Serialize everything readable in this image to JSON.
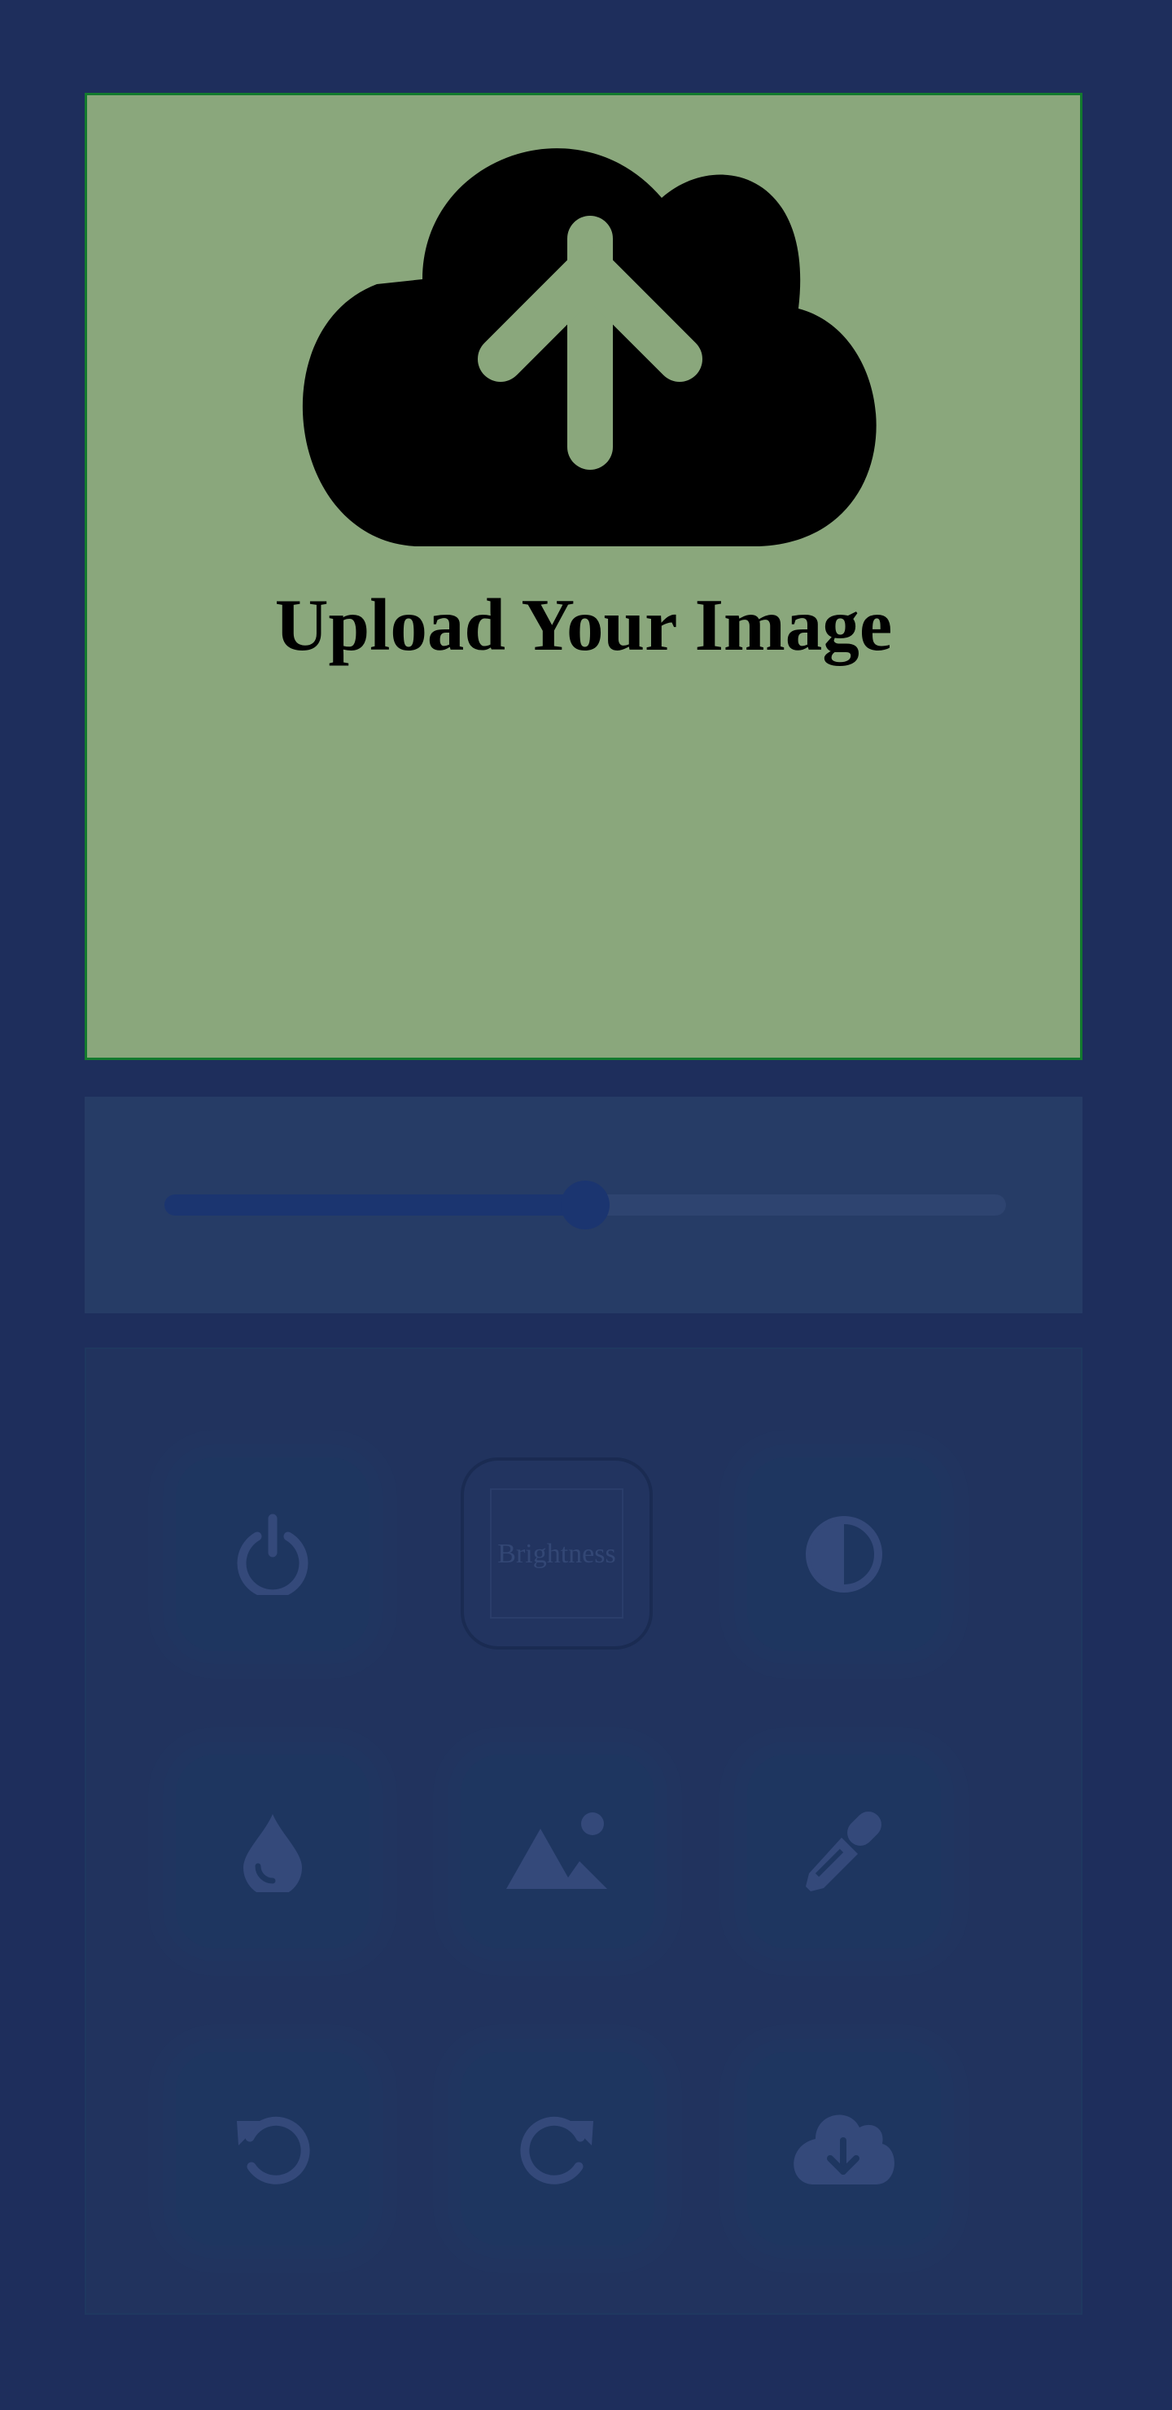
{
  "upload": {
    "title": "Upload Your Image",
    "icon": "cloud-upload-icon"
  },
  "slider": {
    "value": 0.5
  },
  "controls": {
    "buttons": [
      {
        "name": "power-button",
        "icon": "power-icon"
      },
      {
        "name": "brightness-button",
        "label": "Brightness"
      },
      {
        "name": "contrast-button",
        "icon": "contrast-icon"
      },
      {
        "name": "saturation-button",
        "icon": "droplet-icon"
      },
      {
        "name": "image-button",
        "icon": "mountain-image-icon"
      },
      {
        "name": "eyedropper-button",
        "icon": "eyedropper-icon"
      },
      {
        "name": "undo-button",
        "icon": "undo-icon"
      },
      {
        "name": "redo-button",
        "icon": "redo-icon"
      },
      {
        "name": "download-button",
        "icon": "cloud-download-icon"
      }
    ]
  },
  "colors": {
    "background": "#1e2e5c",
    "upload_panel": "#8aa77c",
    "upload_border": "#137a2e",
    "slider_fill": "#1b3570",
    "icon_color": "#34497a"
  }
}
